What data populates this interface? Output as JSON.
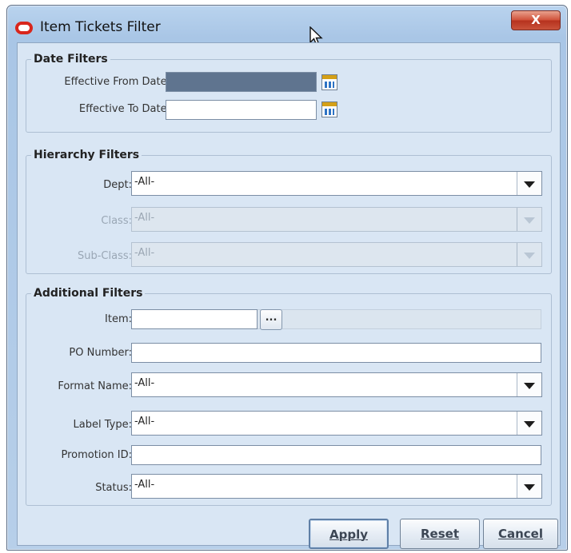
{
  "window": {
    "title": "Item Tickets Filter",
    "close_label": "X"
  },
  "date_filters": {
    "legend": "Date Filters",
    "effective_from_label": "Effective From Date:",
    "effective_from_value": "",
    "effective_to_label": "Effective To Date:",
    "effective_to_value": ""
  },
  "hierarchy_filters": {
    "legend": "Hierarchy Filters",
    "dept_label": "Dept:",
    "dept_value": "-All-",
    "class_label": "Class:",
    "class_value": "-All-",
    "subclass_label": "Sub-Class:",
    "subclass_value": "-All-"
  },
  "additional_filters": {
    "legend": "Additional Filters",
    "item_label": "Item:",
    "item_value": "",
    "item_lookup_label": "...",
    "po_label": "PO Number:",
    "po_value": "",
    "format_label": "Format Name:",
    "format_value": "-All-",
    "label_type_label": "Label Type:",
    "label_type_value": "-All-",
    "promotion_label": "Promotion ID:",
    "promotion_value": "",
    "status_label": "Status:",
    "status_value": "-All-"
  },
  "buttons": {
    "apply": "Apply",
    "reset": "Reset",
    "cancel": "Cancel"
  },
  "colors": {
    "title_gradient": "#b9d3ee",
    "close": "#c9533b",
    "panel": "#d9e6f4",
    "selected_field": "#5f748f"
  },
  "icons": [
    "app-logo-icon",
    "close-icon",
    "calendar-icon",
    "chevron-down-icon",
    "mouse-cursor-icon"
  ]
}
